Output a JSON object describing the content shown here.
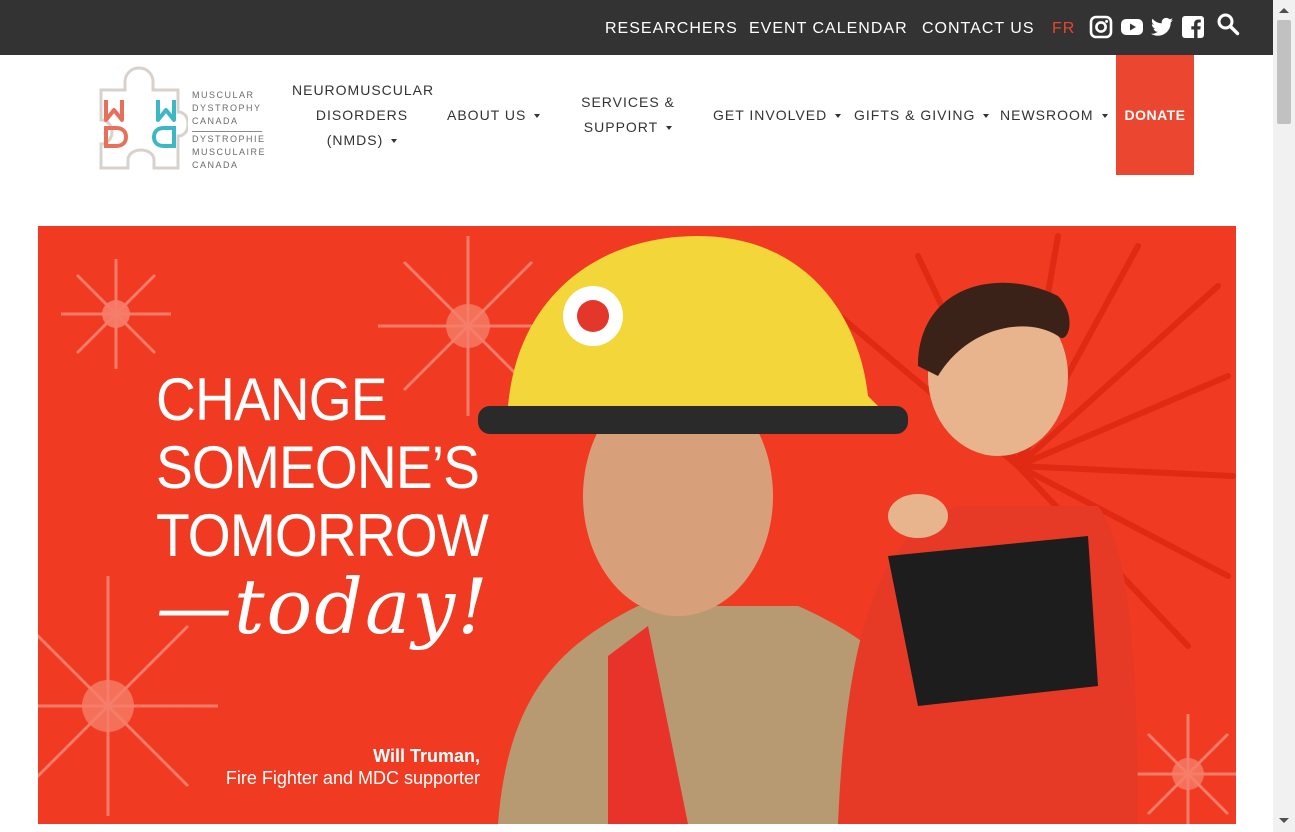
{
  "topbar": {
    "links": [
      "RESEARCHERS",
      "EVENT CALENDAR",
      "CONTACT US"
    ],
    "lang": "FR",
    "social": [
      "instagram-icon",
      "youtube-icon",
      "twitter-icon",
      "facebook-icon",
      "search-icon"
    ]
  },
  "logo": {
    "en_lines": [
      "MUSCULAR",
      "DYSTROPHY",
      "CANADA"
    ],
    "fr_lines": [
      "DYSTROPHIE",
      "MUSCULAIRE",
      "CANADA"
    ]
  },
  "nav": {
    "nmd": [
      "NEUROMUSCULAR",
      "DISORDERS",
      "(NMDS)"
    ],
    "about": "ABOUT US",
    "services": [
      "SERVICES &",
      "SUPPORT"
    ],
    "involved": "GET INVOLVED",
    "gifts": "GIFTS & GIVING",
    "newsroom": "NEWSROOM",
    "donate": "DONATE"
  },
  "hero": {
    "headline": [
      "CHANGE",
      "SOMEONE’S",
      "TOMORROW"
    ],
    "tagline": "—today!",
    "credit_name": "Will Truman,",
    "credit_role": "Fire Fighter and MDC supporter"
  },
  "colors": {
    "accent": "#ea4630",
    "hero_bg": "#f03a22",
    "topbar_bg": "#333333",
    "logo_orange": "#e8705a",
    "logo_teal": "#3bb8c4"
  }
}
